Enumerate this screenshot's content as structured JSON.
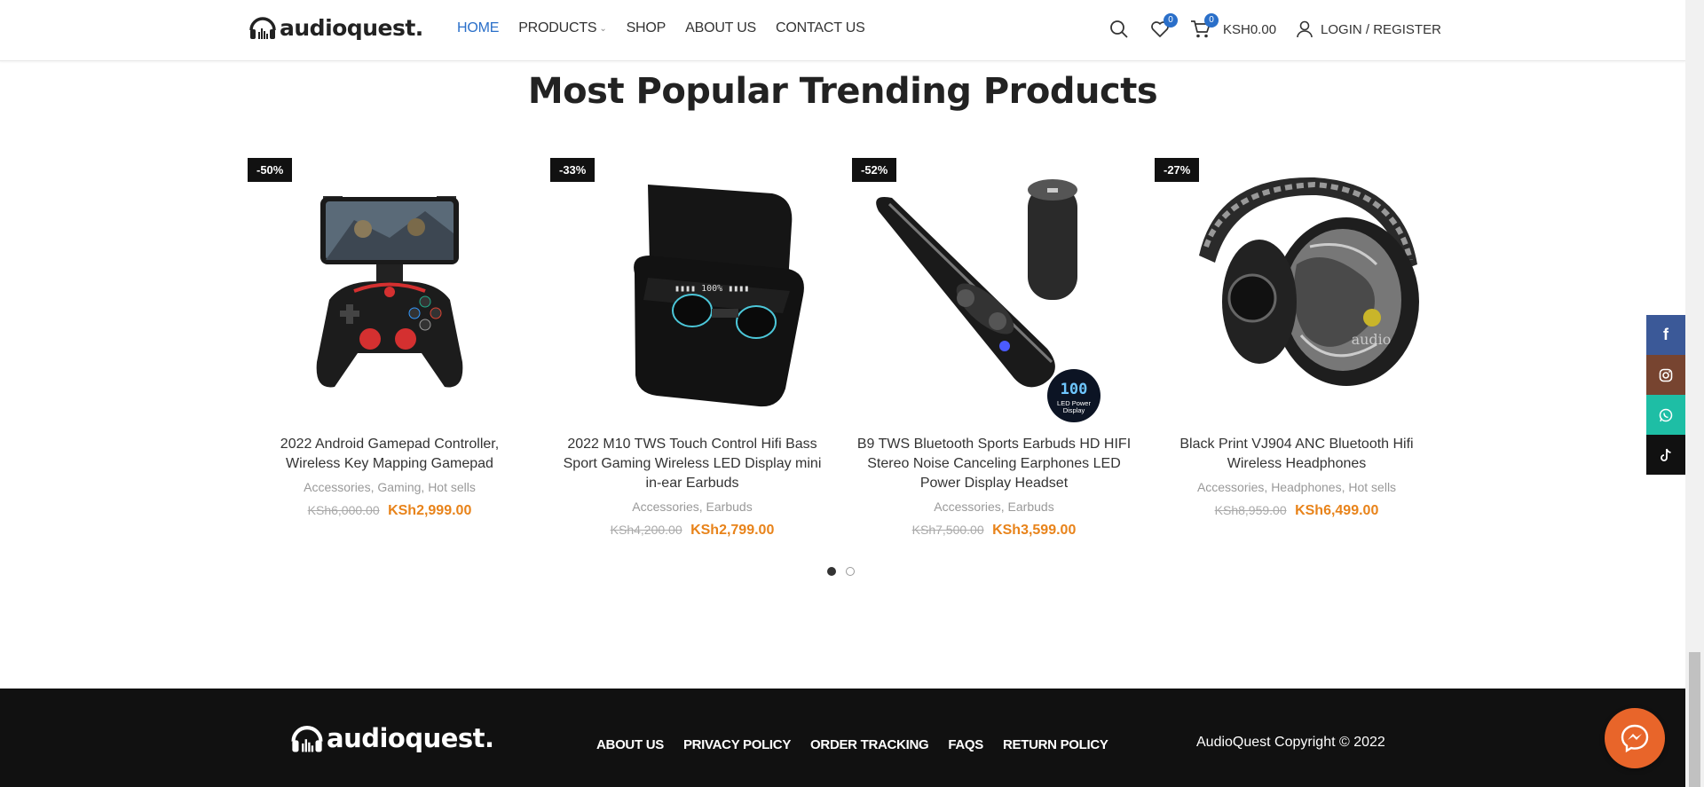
{
  "header": {
    "logo_text": "audioquest.",
    "nav": [
      {
        "label": "HOME",
        "active": true
      },
      {
        "label": "PRODUCTS",
        "has_dropdown": true
      },
      {
        "label": "SHOP"
      },
      {
        "label": "ABOUT US"
      },
      {
        "label": "CONTACT US"
      }
    ],
    "wishlist_count": "0",
    "cart_count": "0",
    "cart_total": "KSH0.00",
    "login_label": "LOGIN / REGISTER"
  },
  "section": {
    "title": "Most Popular Trending Products"
  },
  "products": [
    {
      "discount": "-50%",
      "name": "2022 Android Gamepad Controller, Wireless Key Mapping Gamepad",
      "categories": [
        "Accessories",
        "Gaming",
        "Hot sells"
      ],
      "old_price": "KSh6,000.00",
      "price": "KSh2,999.00",
      "image": "gamepad-image"
    },
    {
      "discount": "-33%",
      "name": "2022 M10 TWS Touch Control Hifi Bass Sport Gaming Wireless LED Display mini in-ear Earbuds",
      "categories": [
        "Accessories",
        "Earbuds"
      ],
      "old_price": "KSh4,200.00",
      "price": "KSh2,799.00",
      "image": "earbuds-case-image"
    },
    {
      "discount": "-52%",
      "name": "B9 TWS Bluetooth Sports Earbuds HD HIFI Stereo Noise Canceling Earphones LED Power Display Headset",
      "categories": [
        "Accessories",
        "Earbuds"
      ],
      "old_price": "KSh7,500.00",
      "price": "KSh3,599.00",
      "image": "tube-earbuds-image",
      "image_text": {
        "display": "100",
        "caption_line1": "LED Power",
        "caption_line2": "Display"
      }
    },
    {
      "discount": "-27%",
      "name": "Black Print VJ904 ANC Bluetooth Hifi Wireless Headphones",
      "categories": [
        "Accessories",
        "Headphones",
        "Hot sells"
      ],
      "old_price": "KSh8,959.00",
      "price": "KSh6,499.00",
      "image": "headphones-image",
      "image_text": {
        "watermark": "audio"
      }
    }
  ],
  "carousel": {
    "pages": 2,
    "current": 1
  },
  "social": [
    {
      "name": "facebook-icon",
      "glyph": "f",
      "color": "#3b5998"
    },
    {
      "name": "instagram-icon",
      "glyph": "◎",
      "color": "#774430"
    },
    {
      "name": "whatsapp-icon",
      "glyph": "✆",
      "color": "#1ebea5"
    },
    {
      "name": "tiktok-icon",
      "glyph": "♪",
      "color": "#111111"
    }
  ],
  "footer": {
    "logo_text": "audioquest.",
    "links": [
      "ABOUT US",
      "PRIVACY POLICY",
      "ORDER TRACKING",
      "FAQS",
      "RETURN POLICY"
    ],
    "copyright": "AudioQuest Copyright © 2022"
  },
  "colors": {
    "accent": "#2a6fc9",
    "price": "#e8831a",
    "footer_bg": "#111111",
    "messenger": "#e8652a"
  }
}
